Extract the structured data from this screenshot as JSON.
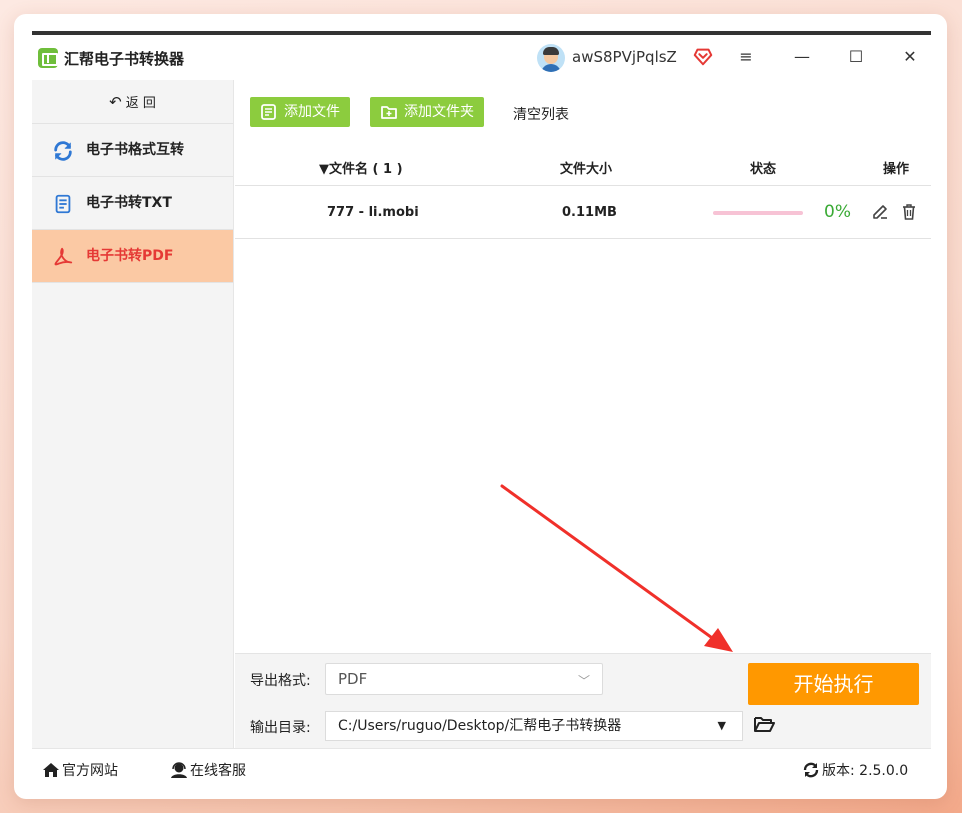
{
  "app": {
    "title": "汇帮电子书转换器"
  },
  "user": {
    "name": "awS8PVjPqlsZ"
  },
  "window_controls": {
    "menu": "≡",
    "minimize": "—",
    "maximize": "☐",
    "close": "✕"
  },
  "sidebar": {
    "back_label": "返 回",
    "items": [
      {
        "label": "电子书格式互转",
        "icon": "convert-icon",
        "active": false
      },
      {
        "label": "电子书转TXT",
        "icon": "document-icon",
        "active": false
      },
      {
        "label": "电子书转PDF",
        "icon": "pdf-icon",
        "active": true
      }
    ]
  },
  "toolbar": {
    "add_file": "添加文件",
    "add_folder": "添加文件夹",
    "clear_list": "清空列表"
  },
  "table": {
    "columns": {
      "filename": "文件名 ( 1 )",
      "size": "文件大小",
      "status": "状态",
      "action": "操作"
    },
    "rows": [
      {
        "filename": "777 - li.mobi",
        "size": "0.11MB",
        "progress": 0,
        "percent": "0%"
      }
    ]
  },
  "settings": {
    "format_label": "导出格式:",
    "format_value": "PDF",
    "output_label": "输出目录:",
    "output_value": "C:/Users/ruguo/Desktop/汇帮电子书转换器"
  },
  "start_button": "开始执行",
  "footer": {
    "website": "官方网站",
    "support": "在线客服",
    "version": "版本:  2.5.0.0"
  },
  "colors": {
    "accent_green": "#8ccc3e",
    "active_bg": "#fbc9a4",
    "active_text": "#e53935",
    "start_orange": "#ff9800",
    "percent_green": "#3aaa35",
    "annotation_red": "#f0302a"
  }
}
